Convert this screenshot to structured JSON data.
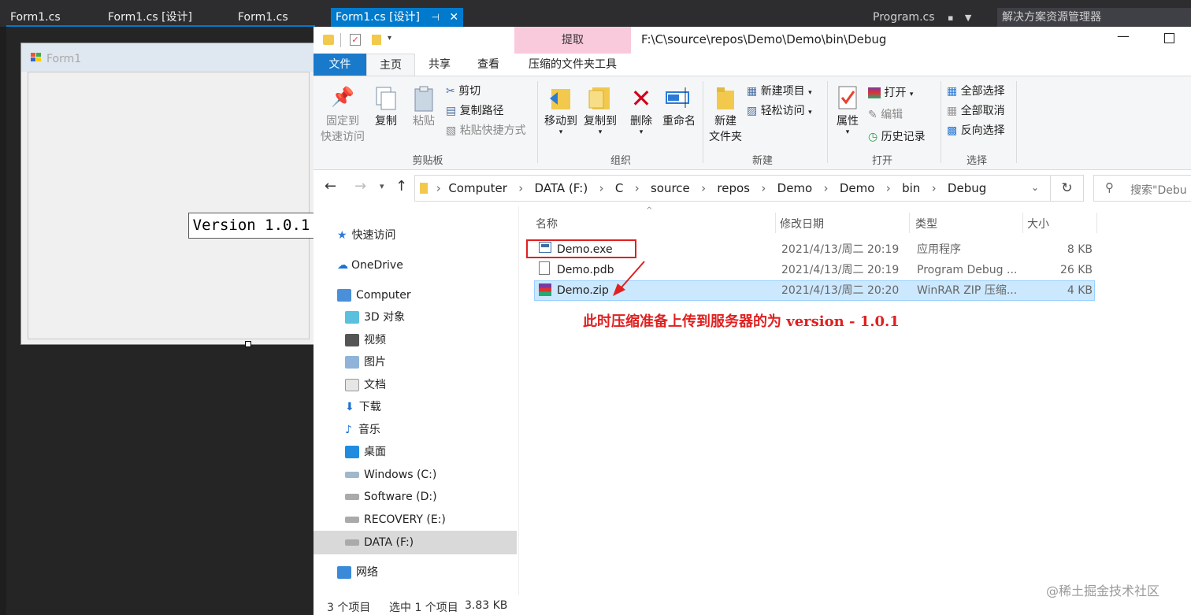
{
  "vs": {
    "tabs": [
      "Form1.cs",
      "Form1.cs [设计]",
      "Form1.cs",
      "Form1.cs [设计]"
    ],
    "active_tab_pin": "⊣",
    "right_tab": "Program.cs",
    "solution_explorer": "解决方案资源管理器",
    "form_title": "Form1",
    "version_label": "Version 1.0.1"
  },
  "explorer": {
    "path_title": "F:\\C\\source\\repos\\Demo\\Demo\\bin\\Debug",
    "context_tab_header": "提取",
    "context_tab": "压缩的文件夹工具",
    "ribbon_tabs": [
      "文件",
      "主页",
      "共享",
      "查看"
    ],
    "ribbon": {
      "pin_label_1": "固定到",
      "pin_label_2": "快速访问",
      "copy": "复制",
      "paste": "粘贴",
      "cut": "剪切",
      "copy_path": "复制路径",
      "paste_shortcut": "粘贴快捷方式",
      "group_clipboard": "剪贴板",
      "move_to": "移动到",
      "copy_to": "复制到",
      "delete": "删除",
      "rename": "重命名",
      "group_organize": "组织",
      "new_folder_1": "新建",
      "new_folder_2": "文件夹",
      "new_item": "新建项目",
      "easy_access": "轻松访问",
      "group_new": "新建",
      "properties": "属性",
      "open": "打开",
      "edit": "编辑",
      "history": "历史记录",
      "group_open": "打开",
      "select_all": "全部选择",
      "select_none": "全部取消",
      "invert_selection": "反向选择",
      "group_select": "选择"
    },
    "breadcrumb": [
      "Computer",
      "DATA (F:)",
      "C",
      "source",
      "repos",
      "Demo",
      "Demo",
      "bin",
      "Debug"
    ],
    "search_placeholder": "搜索\"Debu",
    "nav": [
      {
        "label": "快速访问",
        "icon": "star-icon"
      },
      {
        "label": "OneDrive",
        "icon": "cloud-icon"
      },
      {
        "label": "Computer",
        "icon": "computer-icon"
      },
      {
        "label": "3D 对象",
        "icon": "cube-icon"
      },
      {
        "label": "视频",
        "icon": "video-icon"
      },
      {
        "label": "图片",
        "icon": "picture-icon"
      },
      {
        "label": "文档",
        "icon": "document-icon"
      },
      {
        "label": "下载",
        "icon": "download-icon"
      },
      {
        "label": "音乐",
        "icon": "music-icon"
      },
      {
        "label": "桌面",
        "icon": "desktop-icon"
      },
      {
        "label": "Windows (C:)",
        "icon": "drive-icon"
      },
      {
        "label": "Software (D:)",
        "icon": "drive-icon"
      },
      {
        "label": "RECOVERY (E:)",
        "icon": "drive-icon"
      },
      {
        "label": "DATA (F:)",
        "icon": "drive-icon"
      },
      {
        "label": "网络",
        "icon": "network-icon"
      }
    ],
    "columns": [
      "名称",
      "修改日期",
      "类型",
      "大小"
    ],
    "files": [
      {
        "name": "Demo.exe",
        "date": "2021/4/13/周二 20:19",
        "type": "应用程序",
        "size": "8 KB",
        "icon": "exe-icon"
      },
      {
        "name": "Demo.pdb",
        "date": "2021/4/13/周二 20:19",
        "type": "Program Debug ...",
        "size": "26 KB",
        "icon": "pdb-icon"
      },
      {
        "name": "Demo.zip",
        "date": "2021/4/13/周二 20:20",
        "type": "WinRAR ZIP 压缩...",
        "size": "4 KB",
        "icon": "winrar-icon"
      }
    ],
    "annotation": "此时压缩准备上传到服务器的为 version - 1.0.1",
    "status_items": "3 个项目",
    "status_selected": "选中 1 个项目",
    "status_size": "3.83 KB"
  },
  "watermark": "@稀土掘金技术社区",
  "colors": {
    "vs_bg": "#1e1e1e",
    "vs_tabbar": "#2d2d30",
    "vs_accent": "#007acc",
    "ribbon_file_tab": "#1979ca",
    "context_tab_pink": "#f9c9dc",
    "selection": "#cce8ff",
    "annotation_red": "#e02020"
  }
}
